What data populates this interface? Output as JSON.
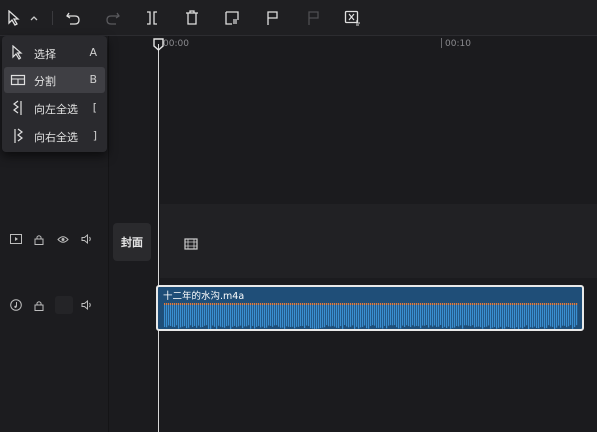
{
  "toolbar": {
    "icons": [
      "select-cursor-icon",
      "chevron-up-icon",
      "undo-icon",
      "redo-icon",
      "split-icon",
      "delete-icon",
      "freeze-frame-icon",
      "marker-icon",
      "marker-disabled-icon",
      "audio-extract-icon"
    ]
  },
  "tool_menu": {
    "items": [
      {
        "label": "选择",
        "key": "A",
        "icon": "cursor-icon",
        "active": false
      },
      {
        "label": "分割",
        "key": "B",
        "icon": "split-tool-icon",
        "active": true
      },
      {
        "label": "向左全选",
        "key": "[",
        "icon": "select-left-icon",
        "active": false
      },
      {
        "label": "向右全选",
        "key": "]",
        "icon": "select-right-icon",
        "active": false
      }
    ]
  },
  "ruler": {
    "ticks": [
      "00:00",
      "00:10"
    ]
  },
  "video_track": {
    "cover_label": "封面",
    "icons": [
      "video-track-icon",
      "lock-icon",
      "eye-icon",
      "volume-icon",
      "film-icon"
    ]
  },
  "audio_track": {
    "clip_name": "十二年的水沟.m4a",
    "icons": [
      "music-icon",
      "lock-icon",
      "volume-icon"
    ]
  },
  "colors": {
    "clip_fill": "#1f4e78",
    "waveform": "#3a8fd0",
    "waveform_top": "#e07b3c"
  }
}
